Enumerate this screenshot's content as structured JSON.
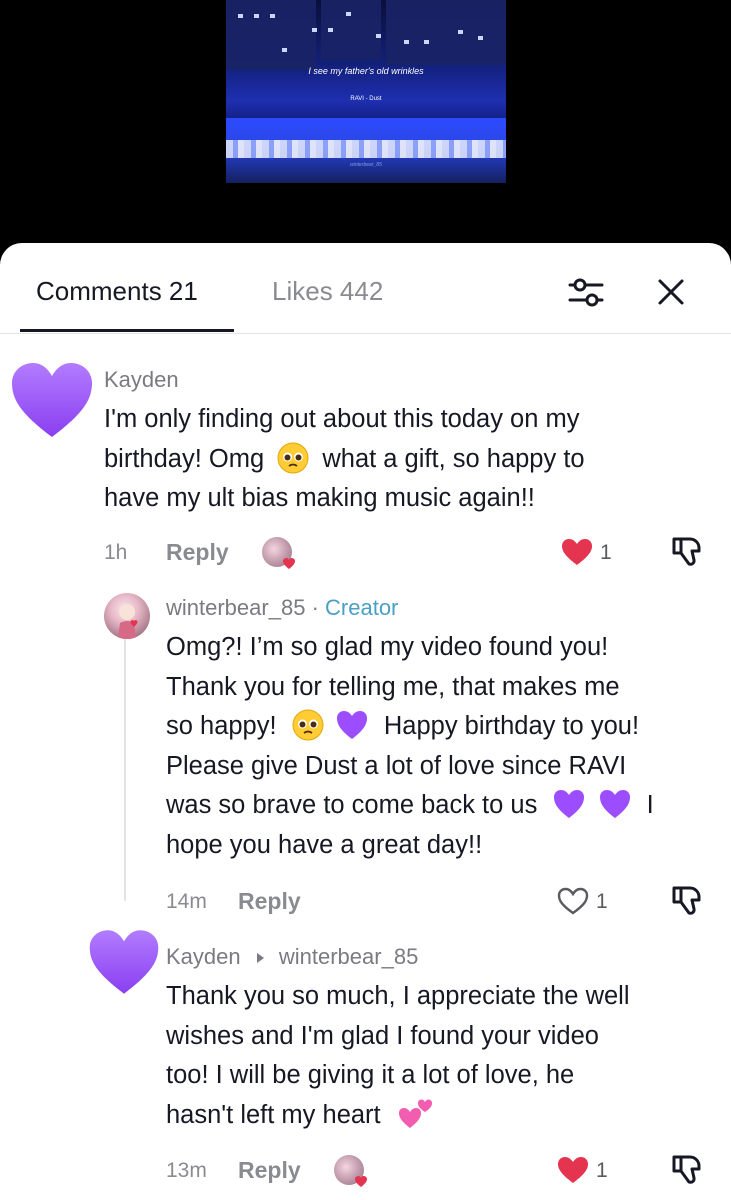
{
  "video": {
    "lyric": "I see my father's old wrinkles",
    "song": "RAVI - Dust",
    "watermark": "winterbear_85"
  },
  "tabs": {
    "comments": "Comments 21",
    "likes": "Likes 442"
  },
  "icons": {
    "filter": "filter-sliders-icon",
    "close": "close-icon",
    "like": "heart-icon",
    "dislike": "dislike-icon"
  },
  "colors": {
    "heart_purple": "#9b4dff",
    "like_red": "#e5344f",
    "creator_blue": "#4a9fc4"
  },
  "comments": [
    {
      "username": "Kayden",
      "lines": [
        "I'm only finding out about this today on my",
        "birthday! Omg",
        "what a gift, so happy to",
        "have my ult bias making music again!!"
      ],
      "time": "1h",
      "reply_label": "Reply",
      "likes": "1",
      "liked": true
    },
    {
      "username": "winterbear_85",
      "separator": "·",
      "badge": "Creator",
      "lines": [
        "Omg?! I’m so glad my video found you!",
        "Thank you for telling me, that makes me",
        "so happy!",
        "Happy birthday to you!",
        "Please give Dust a lot of love since RAVI",
        "was so brave to come back to us",
        "I",
        "hope you have a great day!!"
      ],
      "time": "14m",
      "reply_label": "Reply",
      "likes": "1",
      "liked": false
    },
    {
      "username": "Kayden",
      "reply_to": "winterbear_85",
      "lines": [
        "Thank you so much, I appreciate the well",
        "wishes and I'm glad I found your video",
        "too! I will be giving it a lot of love, he",
        "hasn't left my heart"
      ],
      "time": "13m",
      "reply_label": "Reply",
      "likes": "1",
      "liked": true
    }
  ]
}
